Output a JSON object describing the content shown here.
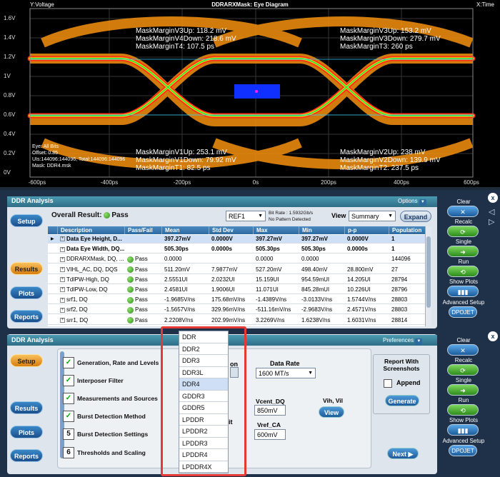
{
  "eye": {
    "title": "DDRARXMask: Eye Diagram",
    "y_label": "Y:Voltage",
    "x_label": "X:Time",
    "y_ticks": [
      "1.6V",
      "1.4V",
      "1.2V",
      "1V",
      "0.8V",
      "0.6V",
      "0.4V",
      "0.2V",
      "0V"
    ],
    "x_ticks": [
      "-600ps",
      "-400ps",
      "-200ps",
      "0s",
      "200ps",
      "400ps",
      "600ps"
    ],
    "ann_top_left": [
      "MaskMarginV3Up: 118.2 mV",
      "MaskMarginV4Down: 218.6 mV",
      "MaskMarginT4: 107.5 ps"
    ],
    "ann_top_right": [
      "MaskMarginV3Up: 153.2 mV",
      "MaskMarginV3Down: 279.7 mV",
      "MaskMarginT3: 260 ps"
    ],
    "ann_bot_left": [
      "MaskMarginV1Up: 253.1 mV",
      "MaskMarginV1Down: 79.92 mV",
      "MaskMarginT1: 82.5 ps"
    ],
    "ann_bot_right": [
      "MaskMarginV2Up: 238 mV",
      "MaskMarginV2Down: 139.9 mV",
      "MaskMarginT2: 237.5 ps"
    ],
    "info": [
      "Eye: All Bits",
      "Offset: 0.85",
      "UIs:144096:144096, Total:144096:144096",
      "Mask: DDR4.msk"
    ]
  },
  "top": {
    "title": "DDR Analysis",
    "options": "Options",
    "overall": "Overall Result:",
    "overall_value": "Pass",
    "ref": "REF1",
    "bitrate": "Bit Rate : 1.5932Gb/s",
    "pattern": "No Pattern Detected",
    "view_label": "View",
    "view_value": "Summary",
    "expand": "Expand",
    "nav": {
      "setup": "Setup",
      "results": "Results",
      "plots": "Plots",
      "reports": "Reports"
    },
    "columns": [
      "Description",
      "Pass/Fail",
      "Mean",
      "Std Dev",
      "Max",
      "Min",
      "p-p",
      "Population"
    ],
    "rows": [
      [
        "Data Eye Height, D...",
        "",
        "397.27mV",
        "0.0000V",
        "397.27mV",
        "397.27mV",
        "0.0000V",
        "1"
      ],
      [
        "Data Eye Width, DQ...",
        "",
        "505.30ps",
        "0.0000s",
        "505.30ps",
        "505.30ps",
        "0.0000s",
        "1"
      ],
      [
        "DDRARXMask, DQ, ...",
        "Pass",
        "0.0000",
        "",
        "0.0000",
        "0.0000",
        "",
        "144096"
      ],
      [
        "VIHL_AC, DQ, DQS",
        "Pass",
        "511.20mV",
        "7.9877mV",
        "527.20mV",
        "498.40mV",
        "28.800mV",
        "27"
      ],
      [
        "TdIPW-High, DQ",
        "Pass",
        "2.5551UI",
        "2.0232UI",
        "15.159UI",
        "954.59mUI",
        "14.205UI",
        "28794"
      ],
      [
        "TdIPW-Low, DQ",
        "Pass",
        "2.4581UI",
        "1.9006UI",
        "11.071UI",
        "845.28mUI",
        "10.226UI",
        "28796"
      ],
      [
        "srf1, DQ",
        "Pass",
        "-1.9685V/ns",
        "175.68mV/ns",
        "-1.4389V/ns",
        "-3.0133V/ns",
        "1.5744V/ns",
        "28803"
      ],
      [
        "srf2, DQ",
        "Pass",
        "-1.5657V/ns",
        "329.96mV/ns",
        "-511.16mV/ns",
        "-2.9683V/ns",
        "2.4571V/ns",
        "28803"
      ],
      [
        "srr1, DQ",
        "Pass",
        "2.2208V/ns",
        "202.99mV/ns",
        "3.2269V/ns",
        "1.6238V/ns",
        "1.6031V/ns",
        "28814"
      ]
    ],
    "right": {
      "clear": "Clear",
      "recalc": "Recalc",
      "single": "Single",
      "run": "Run",
      "show_plots": "Show Plots",
      "adv_setup": "Advanced Setup",
      "dpojet": "DPOJET"
    }
  },
  "bottom": {
    "title": "DDR Analysis",
    "prefs": "Preferences",
    "nav": {
      "setup": "Setup",
      "results": "Results",
      "plots": "Plots",
      "reports": "Reports"
    },
    "steps": [
      {
        "mark": "✓",
        "label": "Generation, Rate and Levels"
      },
      {
        "mark": "✓",
        "label": "Interposer Filter"
      },
      {
        "mark": "✓",
        "label": "Measurements and Sources"
      },
      {
        "mark": "✓",
        "label": "Burst Detection Method"
      },
      {
        "mark": "5",
        "label": "Burst Detection Settings"
      },
      {
        "mark": "6",
        "label": "Thresholds and Scaling"
      }
    ],
    "dropdown_items": [
      "DDR",
      "DDR2",
      "DDR3",
      "DDR3L",
      "DDR4",
      "GDDR3",
      "GDDR5",
      "LPDDR",
      "LPDDR2",
      "LPDDR3",
      "LPDDR4",
      "LPDDR4X"
    ],
    "partial_on": "on",
    "partial_it": "it",
    "data_rate_label": "Data Rate",
    "data_rate_value": "1600 MT/s",
    "vcent_label": "Vcent_DQ",
    "vcent_value": "850mV",
    "vref_label": "Vref_CA",
    "vref_value": "600mV",
    "vih_label": "Vih, Vil",
    "view_btn": "View",
    "report_title": "Report With Screenshots",
    "append": "Append",
    "generate": "Generate",
    "next": "Next",
    "right": {
      "clear": "Clear",
      "recalc": "Recalc",
      "single": "Single",
      "run": "Run",
      "show_plots": "Show Plots",
      "adv_setup": "Advanced Setup",
      "dpojet": "DPOJET"
    }
  },
  "colors": {
    "accent": "#2d6aa0",
    "pass": "#2e8c1c",
    "highlight": "#e53935"
  }
}
